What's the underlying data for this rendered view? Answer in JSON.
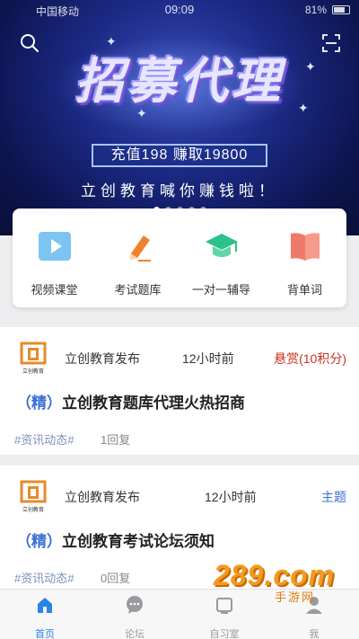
{
  "status_bar": {
    "carrier": "中国移动",
    "time": "09:09",
    "battery": "81%"
  },
  "banner": {
    "headline": "招募代理",
    "promo": "充值198  赚取19800",
    "slogan": "立创教育喊你赚钱啦！",
    "carousel_pages": 5,
    "active_page": 1
  },
  "quick_menu": [
    {
      "label": "视频课堂",
      "icon": "video-play-icon"
    },
    {
      "label": "考试题库",
      "icon": "pen-edit-icon"
    },
    {
      "label": "一对一辅导",
      "icon": "graduation-cap-icon"
    },
    {
      "label": "背单词",
      "icon": "book-icon"
    }
  ],
  "posts": [
    {
      "logo_text": "立创教育",
      "author": "立创教育发布",
      "time": "12小时前",
      "tag": "悬赏(10积分)",
      "tag_color": "#c8321e",
      "title_prefix": "（精）",
      "title": "立创教育题库代理火热招商",
      "category": "#资讯动态#",
      "replies": "1回复"
    },
    {
      "logo_text": "立创教育",
      "author": "立创教育发布",
      "time": "12小时前",
      "tag": "主题",
      "tag_color": "#3b6fd6",
      "title_prefix": "（精）",
      "title": "立创教育考试论坛须知",
      "category": "#资讯动态#",
      "replies": "0回复"
    }
  ],
  "tab_bar": [
    {
      "label": "首页",
      "icon": "home-icon",
      "active": true
    },
    {
      "label": "论坛",
      "icon": "chat-bubble-icon",
      "active": false
    },
    {
      "label": "自习室",
      "icon": "study-room-icon",
      "active": false
    },
    {
      "label": "我",
      "icon": "user-icon",
      "active": false
    }
  ],
  "watermark": {
    "main": "289.com",
    "sub": "手游网"
  },
  "colors": {
    "accent": "#2a84e8",
    "reward": "#c8321e",
    "topic": "#3b6fd6",
    "banner_bg": "#1c2a86"
  }
}
